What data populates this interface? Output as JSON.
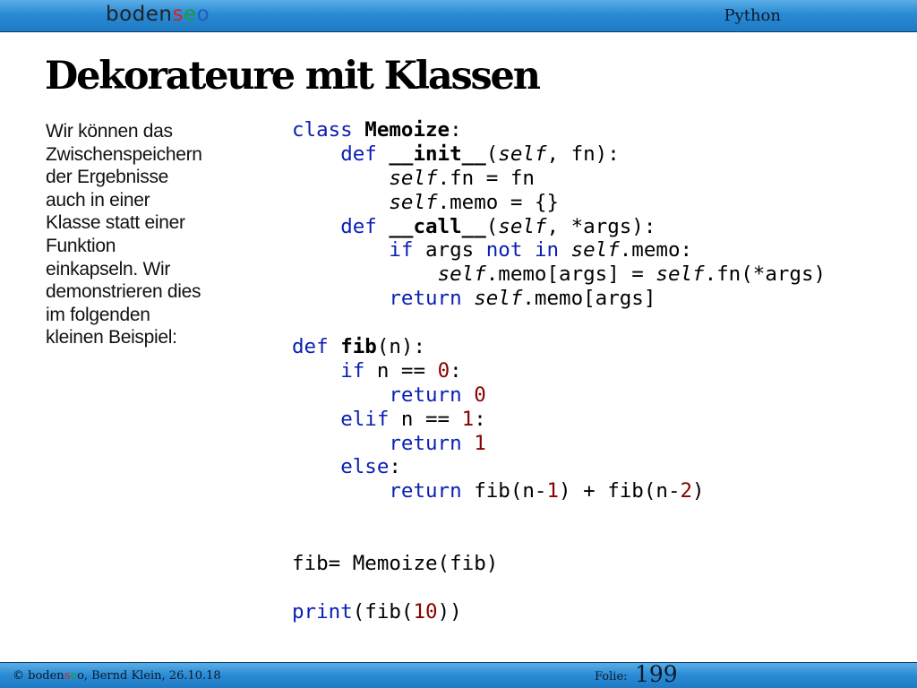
{
  "header": {
    "logo": {
      "p1": "boden",
      "p2": "s",
      "p3": "e",
      "p4": "o"
    },
    "topic": "Python"
  },
  "slide": {
    "title": "Dekorateure mit Klassen",
    "description_lines": [
      "Wir können das",
      "Zwischenspeichern",
      "der Ergebnisse",
      "auch in einer",
      "Klasse statt einer",
      "Funktion",
      "einkapseln. Wir",
      "demonstrieren dies",
      "im folgenden",
      "kleinen Beispiel:"
    ],
    "code": {
      "l1": {
        "a": "class",
        "b": " ",
        "c": "Memoize",
        "d": ":"
      },
      "l2": {
        "a": "    ",
        "b": "def",
        "c": " ",
        "d": "__init__",
        "e": "(",
        "f": "self",
        "g": ", fn):"
      },
      "l3": {
        "a": "        ",
        "b": "self",
        "c": ".fn = fn"
      },
      "l4": {
        "a": "        ",
        "b": "self",
        "c": ".memo = {}"
      },
      "l5": {
        "a": "    ",
        "b": "def",
        "c": " ",
        "d": "__call__",
        "e": "(",
        "f": "self",
        "g": ", *args):"
      },
      "l6": {
        "a": "        ",
        "b": "if",
        "c": " args ",
        "d": "not",
        "e": " ",
        "f": "in",
        "g": " ",
        "h": "self",
        "i": ".memo:"
      },
      "l7": {
        "a": "            ",
        "b": "self",
        "c": ".memo[args] = ",
        "d": "self",
        "e": ".fn(*args)"
      },
      "l8": {
        "a": "        ",
        "b": "return",
        "c": " ",
        "d": "self",
        "e": ".memo[args]"
      },
      "l10": {
        "a": "def",
        "b": " ",
        "c": "fib",
        "d": "(n):"
      },
      "l11": {
        "a": "    ",
        "b": "if",
        "c": " n == ",
        "d": "0",
        "e": ":"
      },
      "l12": {
        "a": "        ",
        "b": "return",
        "c": " ",
        "d": "0"
      },
      "l13": {
        "a": "    ",
        "b": "elif",
        "c": " n == ",
        "d": "1",
        "e": ":"
      },
      "l14": {
        "a": "        ",
        "b": "return",
        "c": " ",
        "d": "1"
      },
      "l15": {
        "a": "    ",
        "b": "else",
        "c": ":"
      },
      "l16": {
        "a": "        ",
        "b": "return",
        "c": " fib(n-",
        "d": "1",
        "e": ") + fib(n-",
        "f": "2",
        "g": ")"
      },
      "l19": {
        "a": "fib= Memoize(fib)"
      },
      "l21": {
        "a": "print",
        "b": "(fib(",
        "c": "10",
        "d": "))"
      }
    }
  },
  "footer": {
    "copyright_symbol": "©",
    "logo": {
      "p1": "boden",
      "p2": "s",
      "p3": "e",
      "p4": "o"
    },
    "author_date": ", Bernd Klein, 26.10.18",
    "folio_label": "Folie:",
    "folio_number": "199"
  }
}
